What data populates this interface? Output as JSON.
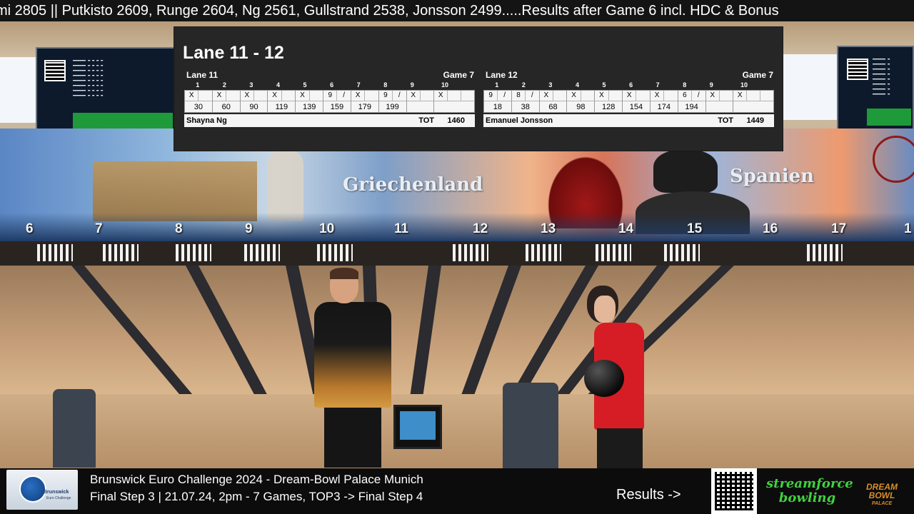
{
  "ticker": {
    "text": "mi 2805 || Putkisto 2609, Runge 2604, Ng 2561, Gullstrand 2538, Jonsson 2499.....Results after Game 6 incl. HDC & Bonus"
  },
  "scene": {
    "mural_left_word": "Griechenland",
    "mural_right_word": "Spanien",
    "lane_numbers": [
      "6",
      "7",
      "8",
      "9",
      "10",
      "11",
      "12",
      "13",
      "14",
      "15",
      "16",
      "17",
      "1"
    ]
  },
  "scoreboard": {
    "title": "Lane 11 - 12",
    "frame_numbers": [
      "1",
      "2",
      "3",
      "4",
      "5",
      "6",
      "7",
      "8",
      "9",
      "10"
    ],
    "games": [
      {
        "lane": "Lane 11",
        "game": "Game 7",
        "player": "Shayna Ng",
        "tot_label": "TOT",
        "tot": "1460",
        "frames": [
          {
            "balls": [
              "X",
              ""
            ],
            "score": "30"
          },
          {
            "balls": [
              "X",
              ""
            ],
            "score": "60"
          },
          {
            "balls": [
              "X",
              ""
            ],
            "score": "90"
          },
          {
            "balls": [
              "X",
              ""
            ],
            "score": "119"
          },
          {
            "balls": [
              "X",
              ""
            ],
            "score": "139"
          },
          {
            "balls": [
              "9",
              "/"
            ],
            "score": "159"
          },
          {
            "balls": [
              "X",
              ""
            ],
            "score": "179"
          },
          {
            "balls": [
              "9",
              "/"
            ],
            "score": "199"
          },
          {
            "balls": [
              "X",
              ""
            ],
            "score": ""
          },
          {
            "balls": [
              "X",
              "",
              ""
            ],
            "score": ""
          }
        ]
      },
      {
        "lane": "Lane 12",
        "game": "Game 7",
        "player": "Emanuel Jonsson",
        "tot_label": "TOT",
        "tot": "1449",
        "frames": [
          {
            "balls": [
              "9",
              "/"
            ],
            "score": "18"
          },
          {
            "balls": [
              "8",
              "/"
            ],
            "score": "38"
          },
          {
            "balls": [
              "X",
              ""
            ],
            "score": "68"
          },
          {
            "balls": [
              "X",
              ""
            ],
            "score": "98"
          },
          {
            "balls": [
              "X",
              ""
            ],
            "score": "128"
          },
          {
            "balls": [
              "X",
              ""
            ],
            "score": "154"
          },
          {
            "balls": [
              "X",
              ""
            ],
            "score": "174"
          },
          {
            "balls": [
              "6",
              "/"
            ],
            "score": "194"
          },
          {
            "balls": [
              "X",
              ""
            ],
            "score": ""
          },
          {
            "balls": [
              "X",
              "",
              ""
            ],
            "score": ""
          }
        ]
      }
    ]
  },
  "banner": {
    "logo_brand": "Brunswick",
    "logo_sub": "Euro Challenge",
    "event_line1": "Brunswick Euro Challenge 2024 - Dream-Bowl Palace Munich",
    "event_line2": "Final Step 3 | 21.07.24, 2pm - 7 Games, TOP3 -> Final Step 4",
    "results_label": "Results ->",
    "sponsor1_line1": "streamforce",
    "sponsor1_line2": "bowling",
    "sponsor2_line1": "DREAM BOWL",
    "sponsor2_line2": "PALACE"
  },
  "colors": {
    "scoreboard_bg": "#262626",
    "sheet_bg": "#f5f5f5",
    "ticker_bg": "#141414",
    "banner_bg": "#0c0c0c",
    "sponsor_green": "#41d13f",
    "sponsor_orange": "#d98d2c"
  }
}
